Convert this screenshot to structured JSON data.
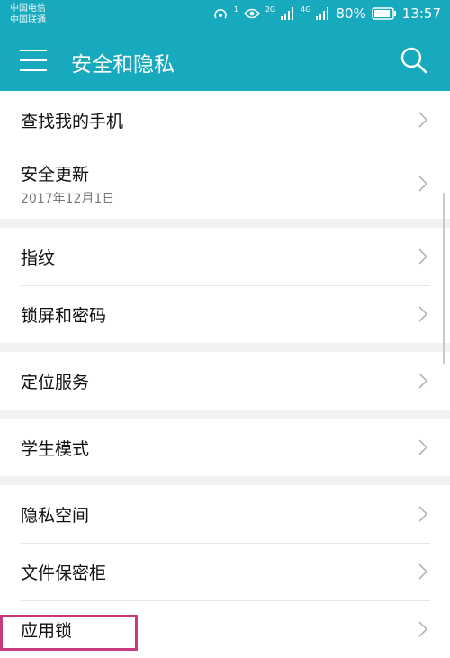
{
  "status_bar": {
    "carrier1": "中国电信",
    "carrier2": "中国联通",
    "network1": "2G",
    "network2": "4G",
    "hotspot_count": "1",
    "battery": "80%",
    "time": "13:57"
  },
  "header": {
    "title": "安全和隐私"
  },
  "groups": [
    {
      "items": [
        {
          "label": "查找我的手机"
        },
        {
          "label": "安全更新",
          "sub": "2017年12月1日"
        }
      ]
    },
    {
      "items": [
        {
          "label": "指纹"
        },
        {
          "label": "锁屏和密码"
        }
      ]
    },
    {
      "items": [
        {
          "label": "定位服务"
        }
      ]
    },
    {
      "items": [
        {
          "label": "学生模式"
        }
      ]
    },
    {
      "items": [
        {
          "label": "隐私空间"
        },
        {
          "label": "文件保密柜"
        },
        {
          "label": "应用锁"
        }
      ]
    }
  ],
  "colors": {
    "header": "#17a9bd",
    "highlight": "#c63a7c"
  }
}
